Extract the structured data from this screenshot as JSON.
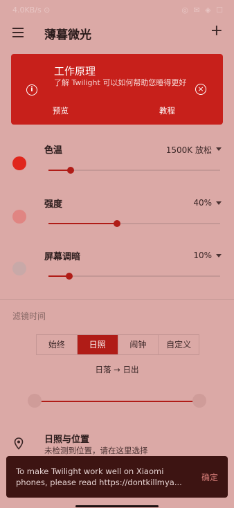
{
  "status_bar": {
    "left": "4.0KB/s ⊙",
    "right": "◎ ✉ ◈ ☐"
  },
  "app": {
    "title": "薄暮微光"
  },
  "card": {
    "title": "工作原理",
    "description": "了解 Twilight 可以如何帮助您睡得更好",
    "preview_label": "预览",
    "tutorial_label": "教程"
  },
  "settings": {
    "color_temp": {
      "label": "色温",
      "value": "1500K 放松",
      "level": 0.13,
      "dot_color": "#e0261c"
    },
    "intensity": {
      "label": "强度",
      "value": "40%",
      "level": 0.4,
      "dot_color": "#e08582"
    },
    "dim": {
      "label": "屏幕调暗",
      "value": "10%",
      "level": 0.12,
      "dot_color": "#c8a9a8"
    }
  },
  "filter_time": {
    "section_title": "滤镜时间",
    "options": [
      "始终",
      "日照",
      "闹钟",
      "自定义"
    ],
    "selected": "日照",
    "range_caption": "日落 → 日出"
  },
  "location": {
    "title": "日照与位置",
    "subtitle": "未检测到位置，请在这里选择"
  },
  "snackbar": {
    "message": "To make Twilight work well on Xiaomi phones, please read https://dontkillmya...",
    "action": "确定"
  },
  "colors": {
    "accent": "#b01c17",
    "card_bg": "#c7201b",
    "background": "#dba9a6",
    "snackbar_bg": "#3d1412"
  }
}
